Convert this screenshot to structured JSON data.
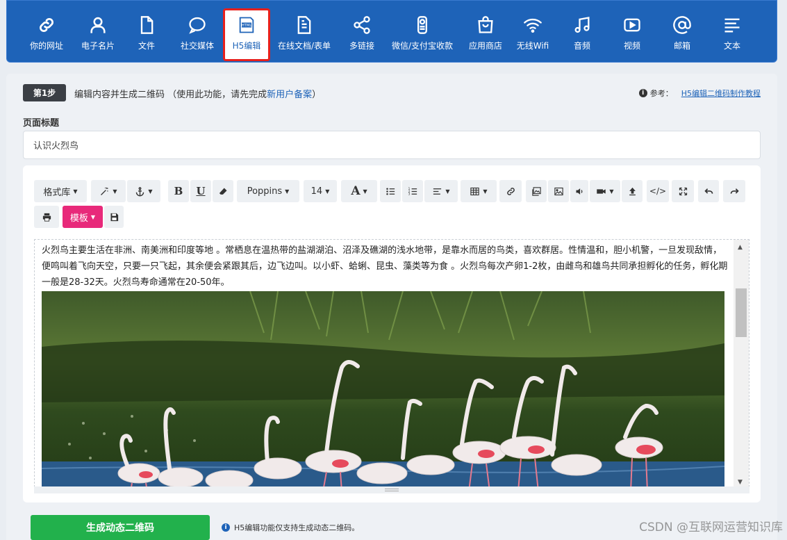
{
  "nav": {
    "items": [
      {
        "label": "你的网址",
        "icon": "link-icon"
      },
      {
        "label": "电子名片",
        "icon": "person-icon"
      },
      {
        "label": "文件",
        "icon": "file-icon"
      },
      {
        "label": "社交媒体",
        "icon": "chat-bubble-icon"
      },
      {
        "label": "H5编辑",
        "icon": "html-file-icon",
        "active": true
      },
      {
        "label": "在线文档/表单",
        "icon": "document-icon"
      },
      {
        "label": "多链接",
        "icon": "share-icon"
      },
      {
        "label": "微信/支付宝收款",
        "icon": "payment-icon"
      },
      {
        "label": "应用商店",
        "icon": "shopping-bag-icon"
      },
      {
        "label": "无线Wifi",
        "icon": "wifi-icon"
      },
      {
        "label": "音频",
        "icon": "music-icon"
      },
      {
        "label": "视频",
        "icon": "video-icon"
      },
      {
        "label": "邮箱",
        "icon": "at-sign-icon"
      },
      {
        "label": "文本",
        "icon": "text-lines-icon"
      }
    ],
    "active_border_color": "#e8201c",
    "bg_color": "#1e63b8"
  },
  "step": {
    "badge": "第1步",
    "text_before": "编辑内容并生成二维码 （使用此功能，请先完成",
    "link": "新用户备案",
    "text_after": "）"
  },
  "reference": {
    "label": "参考：",
    "link": "H5编辑二维码制作教程"
  },
  "page_title": {
    "label": "页面标题",
    "value": "认识火烈鸟"
  },
  "toolbar": {
    "style_lib": "格式库",
    "font_family": "Poppins",
    "font_size": "14",
    "template": "模板"
  },
  "editor": {
    "content": "火烈鸟主要生活在非洲、南美洲和印度等地 。常栖息在温热带的盐湖湖泊、沼泽及礁湖的浅水地带，是靠水而居的鸟类，喜欢群居。性情温和，胆小机警，一旦发现敌情，便鸣叫着飞向天空，只要一只飞起，其余便会紧跟其后，边飞边叫。以小虾、蛤蜊、昆虫、藻类等为食 。火烈鸟每次产卵1-2枚，由雌鸟和雄鸟共同承担孵化的任务，孵化期一般是28-32天。火烈鸟寿命通常在20-50年。"
  },
  "generate": {
    "button": "生成动态二维码",
    "note": "H5编辑功能仅支持生成动态二维码。"
  },
  "watermark": "CSDN @互联网运营知识库"
}
